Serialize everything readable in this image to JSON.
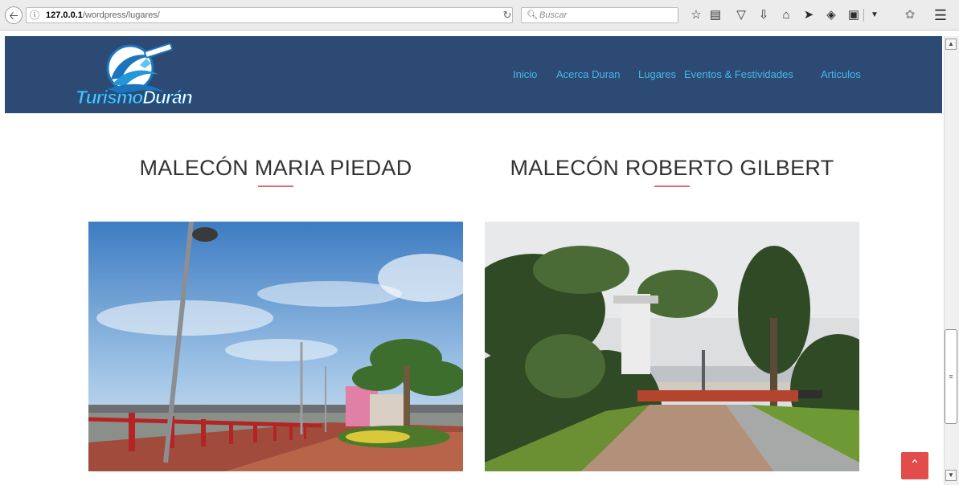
{
  "browser": {
    "url_host": "127.0.0.1",
    "url_path": "/wordpress/lugares/",
    "search_placeholder": "Buscar"
  },
  "site": {
    "logo_part1": "Turismo",
    "logo_part2": "Durán",
    "nav": [
      "Inicio",
      "Acerca Duran",
      "Lugares",
      "Eventos & Festividades",
      "Articulos"
    ]
  },
  "places": [
    {
      "title": "MALECÓN MARIA PIEDAD"
    },
    {
      "title": "MALECÓN ROBERTO GILBERT"
    }
  ],
  "colors": {
    "header_bg": "#2c4a73",
    "nav_link": "#44b9ea",
    "title_underline": "#e36b6b",
    "back_to_top": "#e24c4b"
  },
  "icons": {
    "back_to_top": "chevron-up-icon"
  }
}
